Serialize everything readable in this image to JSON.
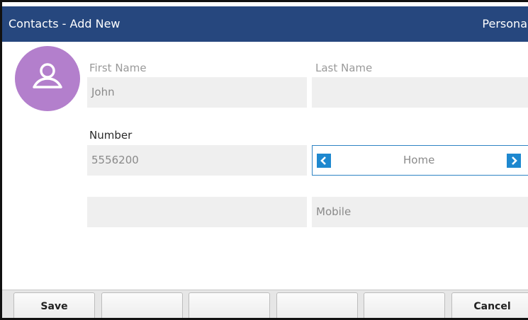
{
  "window": {
    "title": "Contacts - Add New",
    "account": "Persona"
  },
  "avatar": {
    "icon": "person-icon",
    "color": "#b37fcc"
  },
  "form": {
    "first_name": {
      "label": "First Name",
      "value": "John"
    },
    "last_name": {
      "label": "Last Name",
      "value": ""
    },
    "number": {
      "label": "Number",
      "value": "5556200"
    },
    "number_type": {
      "value": "Home"
    },
    "second_number": {
      "value": "",
      "type": "Mobile"
    }
  },
  "softkeys": [
    "Save",
    "",
    "",
    "",
    "",
    "Cancel"
  ],
  "colors": {
    "titlebar": "#26477e",
    "accent": "#1e88cf"
  }
}
